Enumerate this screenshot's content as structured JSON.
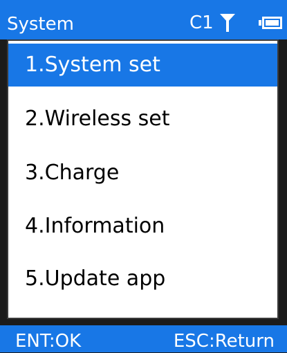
{
  "header": {
    "title": "System",
    "channel": "C1",
    "signal_icon": "antenna-signal-icon",
    "battery_icon": "battery-icon"
  },
  "menu": {
    "selected_index": 0,
    "items": [
      {
        "label": "1.System set"
      },
      {
        "label": "2.Wireless set"
      },
      {
        "label": "3.Charge"
      },
      {
        "label": "4.Information"
      },
      {
        "label": "5.Update app"
      }
    ]
  },
  "footer": {
    "left_hint": "ENT:OK",
    "right_hint": "ESC:Return"
  },
  "colors": {
    "accent": "#1877e6",
    "background": "#1b1b1b",
    "panel": "#ffffff",
    "text_on_accent": "#ffffff",
    "text": "#000000"
  }
}
